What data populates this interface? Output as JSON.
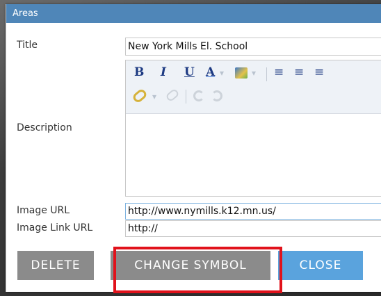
{
  "window": {
    "title": "Areas"
  },
  "form": {
    "title_label": "Title",
    "title_value": "New York Mills El. School",
    "description_label": "Description",
    "description_value": "",
    "image_url_label": "Image URL",
    "image_url_value": "http://www.nymills.k12.mn.us/",
    "image_link_label": "Image Link URL",
    "image_link_value": "http://"
  },
  "toolbar": {
    "bold": "B",
    "italic": "I",
    "underline": "U",
    "font_color": "A",
    "dropdown": "▾",
    "align_left": "≡",
    "align_center": "≡",
    "align_right": "≡"
  },
  "buttons": {
    "delete": "DELETE",
    "change_symbol": "CHANGE SYMBOL",
    "close": "CLOSE"
  },
  "colors": {
    "titlebar": "#4f86b8",
    "button_gray": "#8b8b8b",
    "button_blue": "#5aa3dd",
    "highlight": "#e1121b"
  }
}
